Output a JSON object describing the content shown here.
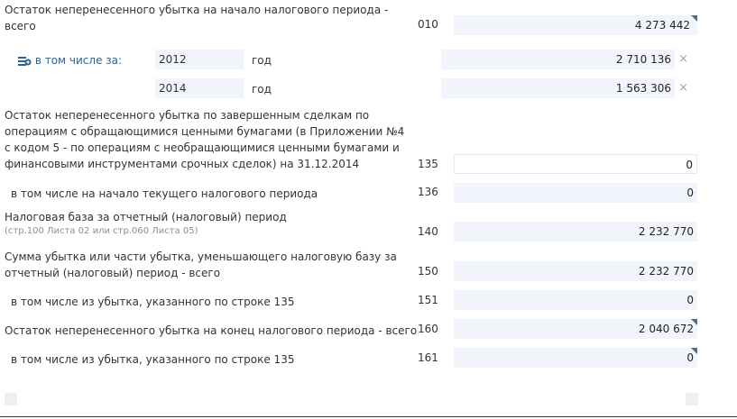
{
  "rows": {
    "r010": {
      "label_line1": "Остаток неперенесенного убытка на начало налогового периода -",
      "label_line2": "всего",
      "code": "010",
      "value": "4 273 442"
    },
    "in_total": {
      "label": "в том числе за:",
      "year_unit": "год",
      "entries": [
        {
          "year": "2012",
          "value": "2 710 136"
        },
        {
          "year": "2014",
          "value": "1 563 306"
        }
      ]
    },
    "r135": {
      "label_line1": "Остаток неперенесенного убытка по завершенным сделкам по",
      "label_line2": "операциям с обращающимися ценными бумагами (в Приложении №4",
      "label_line3": "с кодом 5 - по операциям с необращающимися ценными бумагами и",
      "label_line4": "финансовыми инструментами срочных сделок) на 31.12.2014",
      "code": "135",
      "value": "0"
    },
    "r136": {
      "label": "в том числе на начало текущего налогового периода",
      "code": "136",
      "value": "0"
    },
    "r140": {
      "label": "Налоговая база за отчетный (налоговый) период",
      "hint": "(стр.100 Листа 02 или стр.060 Листа 05)",
      "code": "140",
      "value": "2 232 770"
    },
    "r150": {
      "label_line1": "Сумма убытка или части убытка, уменьшающего налоговую базу за",
      "label_line2": "отчетный (налоговый) период - всего",
      "code": "150",
      "value": "2 232 770"
    },
    "r151": {
      "label": "в том числе из убытка, указанного по строке 135",
      "code": "151",
      "value": "0"
    },
    "r160": {
      "label": "Остаток неперенесенного убытка на конец налогового периода - всего",
      "code": "160",
      "value": "2 040 672"
    },
    "r161": {
      "label": "в том числе из убытка, указанного по строке 135",
      "code": "161",
      "value": "0"
    }
  },
  "icons": {
    "add_row": "add-rows-icon",
    "remove": "close-icon"
  },
  "colors": {
    "field_bg": "#f1f5fb",
    "link": "#2a6496",
    "corner_marker": "#546a88"
  }
}
